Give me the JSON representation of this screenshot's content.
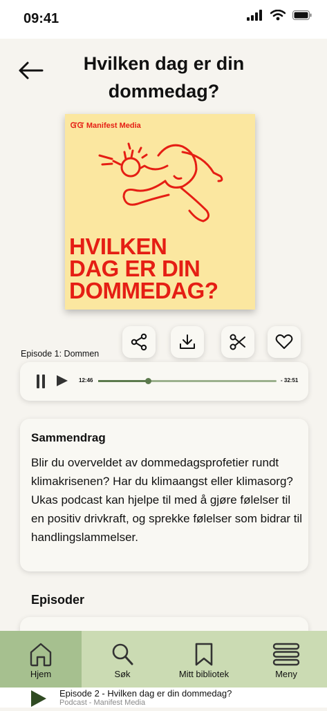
{
  "status": {
    "time": "09:41"
  },
  "header": {
    "title": "Hvilken dag er din dommedag?"
  },
  "cover": {
    "brand": "Manifest Media",
    "title_lines": [
      "HVILKEN",
      "DAG ER DIN",
      "DOMMEDAG?"
    ]
  },
  "player": {
    "episode_label": "Episode 1: Dommen",
    "elapsed": "12:46",
    "remaining": "- 32:51",
    "progress": 0.28
  },
  "summary": {
    "heading": "Sammendrag",
    "body": "Blir du overveldet av dommedagsprofetier rundt klimakrisenen? Har du klimaangst eller klimasorg? Ukas podcast kan hjelpe til med å gjøre følelser til en positiv drivkraft, og sprekke følelser som bidrar til handlingslammelser."
  },
  "episodes": {
    "heading": "Episoder"
  },
  "nav": {
    "items": [
      {
        "label": "Hjem",
        "icon": "home-icon"
      },
      {
        "label": "Søk",
        "icon": "search-icon"
      },
      {
        "label": "Mitt bibliotek",
        "icon": "bookmark-icon"
      },
      {
        "label": "Meny",
        "icon": "menu-icon"
      }
    ]
  },
  "mini_player": {
    "title": "Episode 2 - Hvilken dag er din dommedag?",
    "subtitle": "Podcast - Manifest Media"
  },
  "colors": {
    "accent_red": "#e51e14",
    "nav_bg": "#cbdbb3",
    "nav_active": "#a6c08f",
    "progress": "#5c7a4d"
  }
}
